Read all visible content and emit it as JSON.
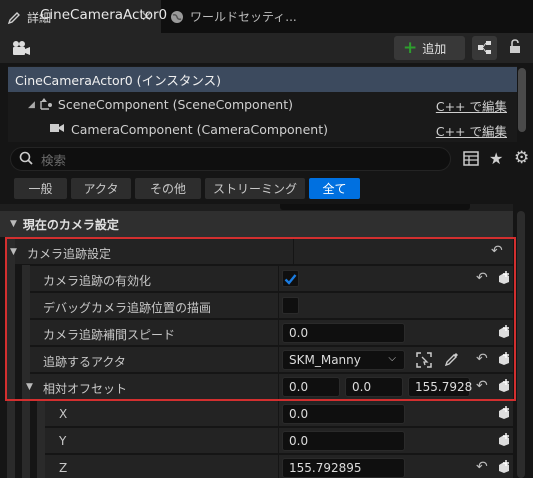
{
  "tabs": [
    {
      "label": "詳細",
      "icon": "pencil-icon",
      "active": true
    },
    {
      "label": "ワールドセッティ...",
      "icon": "globe-icon",
      "active": false
    }
  ],
  "actor": {
    "title": "CineCameraActor0",
    "add_label": "追加"
  },
  "tree": [
    {
      "label": "CineCameraActor0 (インスタンス)",
      "selected": true
    },
    {
      "label": "SceneComponent (SceneComponent)",
      "link": "C++ で編集"
    },
    {
      "label": "CameraComponent (CameraComponent)",
      "link": "C++ で編集"
    }
  ],
  "search": {
    "placeholder": "検索"
  },
  "filters": [
    "一般",
    "アクタ",
    "その他",
    "ストリーミング",
    "全て"
  ],
  "active_filter": "全て",
  "section": {
    "title": "現在のカメラ設定"
  },
  "group": {
    "title": "カメラ追跡設定"
  },
  "props": {
    "enable": {
      "label": "カメラ追跡の有効化",
      "checked": true
    },
    "debug": {
      "label": "デバッグカメラ追跡位置の描画",
      "checked": false
    },
    "speed": {
      "label": "カメラ追跡補間スピード",
      "value": "0.0"
    },
    "actor": {
      "label": "追跡するアクタ",
      "value": "SKM_Manny"
    },
    "offset": {
      "label": "相対オフセット",
      "x": "0.0",
      "y": "0.0",
      "z": "155.7928"
    },
    "x": {
      "label": "X",
      "value": "0.0"
    },
    "y": {
      "label": "Y",
      "value": "0.0"
    },
    "z": {
      "label": "Z",
      "value": "155.792895"
    }
  },
  "colors": {
    "accent": "#0070e0",
    "highlight": "#d32f2f",
    "selection": "#3c4a5e",
    "check": "#1a7be0"
  }
}
